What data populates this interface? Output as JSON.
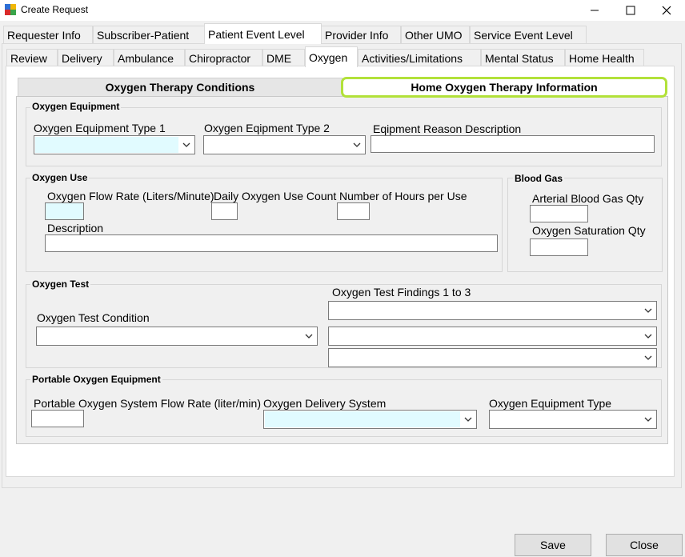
{
  "window": {
    "title": "Create Request"
  },
  "main_tabs": [
    "Requester Info",
    "Subscriber-Patient",
    "Patient Event Level",
    "Provider Info",
    "Other UMO",
    "Service Event Level"
  ],
  "event_tabs": [
    "Review",
    "Delivery",
    "Ambulance",
    "Chiropractor",
    "DME",
    "Oxygen",
    "Activities/Limitations",
    "Mental Status",
    "Home Health"
  ],
  "sub_tabs": {
    "conditions": "Oxygen Therapy Conditions",
    "home": "Home Oxygen Therapy Information"
  },
  "equipment": {
    "title": "Oxygen Equipment",
    "type1_label": "Oxygen Equipment Type 1",
    "type1_value": "",
    "type2_label": "Oxygen Eqipment Type 2",
    "type2_value": "",
    "reason_label": "Eqipment Reason Description",
    "reason_value": ""
  },
  "use": {
    "title": "Oxygen Use",
    "flow_label": "Oxygen Flow Rate (Liters/Minute)",
    "flow_value": "",
    "daily_label": "Daily Oxygen Use Count",
    "daily_value": "",
    "hours_label": "Number of Hours per Use",
    "hours_value": "",
    "desc_label": "Description",
    "desc_value": ""
  },
  "blood_gas": {
    "title": "Blood Gas",
    "arterial_label": "Arterial Blood Gas Qty",
    "arterial_value": "",
    "saturation_label": "Oxygen Saturation Qty",
    "saturation_value": ""
  },
  "test": {
    "title": "Oxygen Test",
    "condition_label": "Oxygen Test Condition",
    "condition_value": "",
    "findings_label": "Oxygen Test Findings 1 to 3",
    "finding1": "",
    "finding2": "",
    "finding3": ""
  },
  "portable": {
    "title": "Portable Oxygen Equipment",
    "flow_label": "Portable Oxygen System Flow Rate (liter/min)",
    "flow_value": "",
    "delivery_label": "Oxygen Delivery System",
    "delivery_value": "",
    "equip_label": "Oxygen Equipment Type",
    "equip_value": ""
  },
  "buttons": {
    "save": "Save",
    "close": "Close"
  },
  "icons": {
    "minimize": "minimize-icon",
    "maximize": "maximize-icon",
    "close": "close-icon",
    "dropdown": "chevron-down-icon"
  },
  "colors": {
    "highlight": "#b2e13a",
    "field_focus": "#e1fbff"
  }
}
